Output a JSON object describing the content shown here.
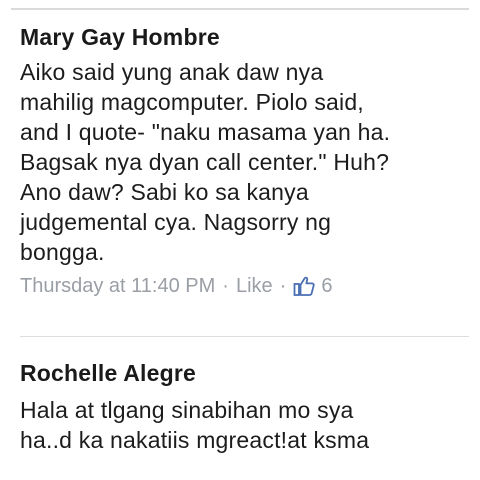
{
  "comments": [
    {
      "author": "Mary Gay Hombre",
      "lines": [
        "Aiko said yung anak daw nya",
        "mahilig magcomputer. Piolo said,",
        "and I quote- \"naku masama yan ha.",
        "Bagsak nya dyan call center.\" Huh?",
        "Ano daw? Sabi ko sa kanya",
        "judgemental cya. Nagsorry ng",
        "bongga."
      ],
      "timestamp": "Thursday at 11:40 PM",
      "separator": "·",
      "like_label": "Like",
      "like_count": "6",
      "like_icon": "thumbs-up-icon"
    },
    {
      "author": "Rochelle Alegre",
      "lines": [
        "Hala at tlgang sinabihan mo sya",
        "ha..d ka nakatiis mgreact!at ksma"
      ]
    }
  ],
  "colors": {
    "text": "#1c1c1c",
    "meta": "#9a9ea5",
    "like_icon": "#4a6fb5",
    "divider": "#dcdddf"
  }
}
